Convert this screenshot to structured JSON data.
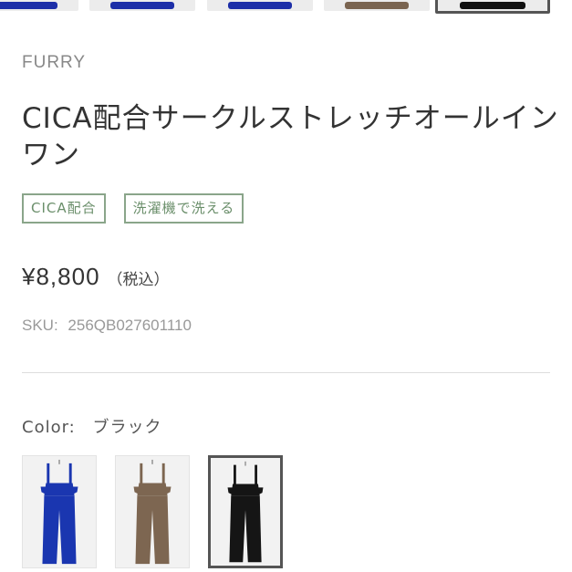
{
  "gallery": {
    "thumbnails": [
      {
        "color": "#1d2fa8",
        "selected": false
      },
      {
        "color": "#1d2fa8",
        "selected": false
      },
      {
        "color": "#1d2fa8",
        "selected": false
      },
      {
        "color": "#7a6450",
        "selected": false
      },
      {
        "color": "#111111",
        "selected": true
      }
    ]
  },
  "product": {
    "brand": "FURRY",
    "title": "CICA配合サークルストレッチオールインワン",
    "tags": [
      "CICA配合",
      "洗濯機で洗える"
    ],
    "price": "¥8,800",
    "price_note": "（税込）",
    "sku_label": "SKU:",
    "sku_value": "256QB027601110"
  },
  "color_option": {
    "label": "Color:",
    "selected_value": "ブラック",
    "swatches": [
      {
        "name": "blue",
        "fill": "#1a36b0",
        "selected": false
      },
      {
        "name": "brown",
        "fill": "#7d6651",
        "selected": false
      },
      {
        "name": "black",
        "fill": "#151515",
        "selected": true
      }
    ]
  },
  "colors": {
    "tag_border": "#8aa58a",
    "tag_text": "#6b8f6b",
    "brand_text": "#888888",
    "selected_border": "#555555"
  }
}
